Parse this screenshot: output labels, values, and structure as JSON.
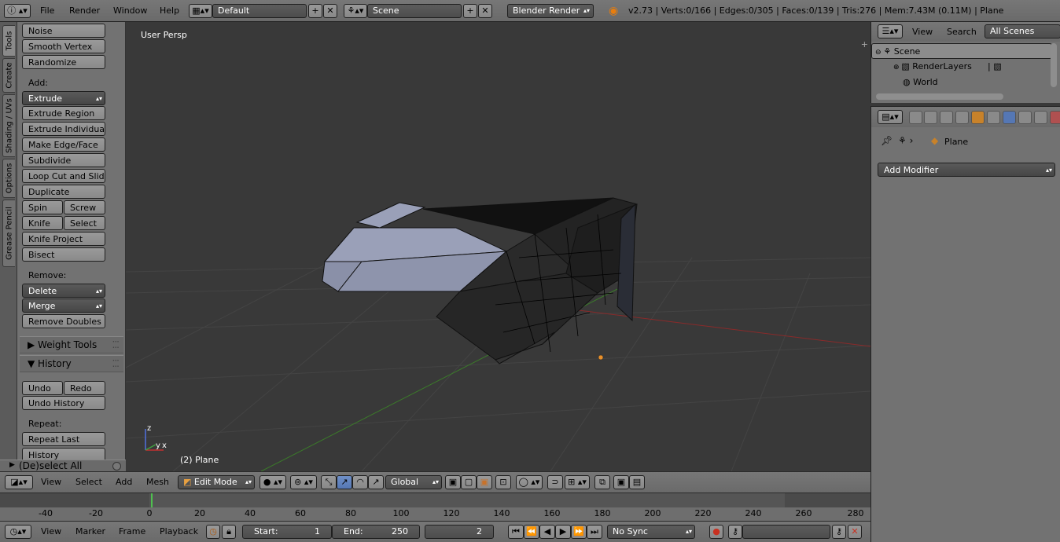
{
  "topbar": {
    "menus": [
      "File",
      "Render",
      "Window",
      "Help"
    ],
    "layout": "Default",
    "scene": "Scene",
    "engine": "Blender Render",
    "stats": "v2.73 | Verts:0/166 | Edges:0/305 | Faces:0/139 | Tris:276 | Mem:7.43M (0.11M) | Plane"
  },
  "tabs": [
    "Tools",
    "Create",
    "Shading / UVs",
    "Options",
    "Grease Pencil"
  ],
  "shelf": {
    "top_buttons": [
      "Noise",
      "Smooth Vertex",
      "Randomize"
    ],
    "add_label": "Add:",
    "extrude": "Extrude",
    "add_buttons": [
      "Extrude Region",
      "Extrude Individual",
      "Make Edge/Face",
      "Subdivide",
      "Loop Cut and Slide"
    ],
    "duplicate": "Duplicate",
    "spin": "Spin",
    "screw": "Screw",
    "knife": "Knife",
    "select": "Select",
    "knife_project": "Knife Project",
    "bisect": "Bisect",
    "remove_label": "Remove:",
    "delete": "Delete",
    "merge": "Merge",
    "remove_doubles": "Remove Doubles",
    "weight_tools": "Weight Tools",
    "history": "History",
    "undo": "Undo",
    "redo": "Redo",
    "undo_history": "Undo History",
    "repeat_label": "Repeat:",
    "repeat_last": "Repeat Last",
    "history_btn": "History",
    "deselect_all": "(De)select All"
  },
  "viewport": {
    "title": "User Persp",
    "object_label": "(2) Plane",
    "axis_x": "x",
    "axis_y": "y",
    "axis_z": "z"
  },
  "view_header": {
    "menus": [
      "View",
      "Select",
      "Add",
      "Mesh"
    ],
    "mode": "Edit Mode",
    "orientation": "Global"
  },
  "timeline": {
    "ticks": [
      "-40",
      "-20",
      "0",
      "20",
      "40",
      "60",
      "80",
      "100",
      "120",
      "140",
      "160",
      "180",
      "200",
      "220",
      "240",
      "260",
      "280"
    ],
    "menus": [
      "View",
      "Marker",
      "Frame",
      "Playback"
    ],
    "start_label": "Start:",
    "start_value": "1",
    "end_label": "End:",
    "end_value": "250",
    "current_frame": "2",
    "sync": "No Sync"
  },
  "outliner": {
    "menus": [
      "View",
      "Search"
    ],
    "filter": "All Scenes",
    "rows": [
      "Scene",
      "RenderLayers",
      "World"
    ]
  },
  "properties": {
    "object": "Plane",
    "add_modifier": "Add Modifier"
  }
}
